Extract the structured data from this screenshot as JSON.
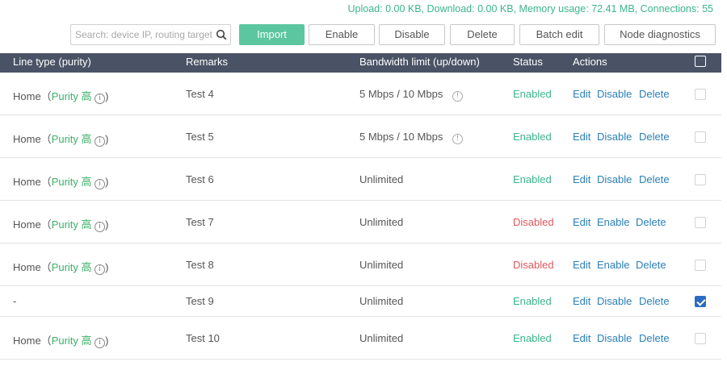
{
  "stats": {
    "upload_label": "Upload:",
    "upload_value": "0.00 KB,",
    "download_label": "Download:",
    "download_value": "0.00 KB,",
    "memory_label": "Memory usage:",
    "memory_value": "72.41 MB,",
    "connections_label": "Connections:",
    "connections_value": "55"
  },
  "toolbar": {
    "search_placeholder": "Search: device IP, routing target",
    "search_icon": "search-icon",
    "import": "Import",
    "enable": "Enable",
    "disable": "Disable",
    "delete": "Delete",
    "batch_edit": "Batch edit",
    "node_diagnostics": "Node diagnostics"
  },
  "table": {
    "headers": {
      "line_type": "Line type (purity)",
      "remarks": "Remarks",
      "bandwidth": "Bandwidth limit (up/down)",
      "status": "Status",
      "actions": "Actions"
    },
    "rows": [
      {
        "line_prefix": "Home（",
        "purity": "Purity 高",
        "line_suffix": ")",
        "remarks": "Test 4",
        "bandwidth": "5 Mbps / 10 Mbps",
        "bw_info": true,
        "status": "Enabled",
        "toggle": "Disable",
        "edit": "Edit",
        "delete": "Delete",
        "checked": false
      },
      {
        "line_prefix": "Home（",
        "purity": "Purity 高",
        "line_suffix": ")",
        "remarks": "Test 5",
        "bandwidth": "5 Mbps / 10 Mbps",
        "bw_info": true,
        "status": "Enabled",
        "toggle": "Disable",
        "edit": "Edit",
        "delete": "Delete",
        "checked": false
      },
      {
        "line_prefix": "Home（",
        "purity": "Purity 高",
        "line_suffix": ")",
        "remarks": "Test 6",
        "bandwidth": "Unlimited",
        "bw_info": false,
        "status": "Enabled",
        "toggle": "Disable",
        "edit": "Edit",
        "delete": "Delete",
        "checked": false
      },
      {
        "line_prefix": "Home（",
        "purity": "Purity 高",
        "line_suffix": ")",
        "remarks": "Test 7",
        "bandwidth": "Unlimited",
        "bw_info": false,
        "status": "Disabled",
        "toggle": "Enable",
        "edit": "Edit",
        "delete": "Delete",
        "checked": false
      },
      {
        "line_prefix": "Home（",
        "purity": "Purity 高",
        "line_suffix": ")",
        "remarks": "Test 8",
        "bandwidth": "Unlimited",
        "bw_info": false,
        "status": "Disabled",
        "toggle": "Enable",
        "edit": "Edit",
        "delete": "Delete",
        "checked": false
      },
      {
        "line_prefix": "-",
        "purity": "",
        "line_suffix": "",
        "remarks": "Test 9",
        "bandwidth": "Unlimited",
        "bw_info": false,
        "status": "Enabled",
        "toggle": "Disable",
        "edit": "Edit",
        "delete": "Delete",
        "checked": true
      },
      {
        "line_prefix": "Home（",
        "purity": "Purity 高",
        "line_suffix": ")",
        "remarks": "Test 10",
        "bandwidth": "Unlimited",
        "bw_info": false,
        "status": "Enabled",
        "toggle": "Disable",
        "edit": "Edit",
        "delete": "Delete",
        "checked": false
      }
    ]
  },
  "colors": {
    "accent": "#5cc6a0",
    "header_bg": "#4a5366",
    "enabled": "#3bb58a",
    "disabled": "#e0575b",
    "link": "#2a7fb8",
    "purity": "#3bb06a"
  }
}
